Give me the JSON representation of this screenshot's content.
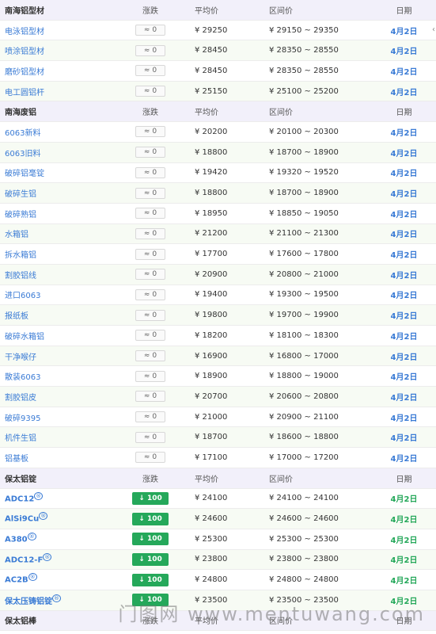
{
  "columns": {
    "change": "涨跌",
    "avg": "平均价",
    "range": "区间价",
    "date": "日期"
  },
  "sections": [
    {
      "title": "南海铝型材",
      "rows": [
        {
          "name": "电泳铝型材",
          "change": "≈ 0",
          "avg": "¥ 29250",
          "range": "¥ 29150 ~ 29350",
          "date": "4月2日"
        },
        {
          "name": "喷涂铝型材",
          "change": "≈ 0",
          "avg": "¥ 28450",
          "range": "¥ 28350 ~ 28550",
          "date": "4月2日"
        },
        {
          "name": "磨砂铝型材",
          "change": "≈ 0",
          "avg": "¥ 28450",
          "range": "¥ 28350 ~ 28550",
          "date": "4月2日"
        },
        {
          "name": "电工圆铝杆",
          "change": "≈ 0",
          "avg": "¥ 25150",
          "range": "¥ 25100 ~ 25200",
          "date": "4月2日"
        }
      ]
    },
    {
      "title": "南海废铝",
      "rows": [
        {
          "name": "6063新料",
          "change": "≈ 0",
          "avg": "¥ 20200",
          "range": "¥ 20100 ~ 20300",
          "date": "4月2日"
        },
        {
          "name": "6063旧料",
          "change": "≈ 0",
          "avg": "¥ 18800",
          "range": "¥ 18700 ~ 18900",
          "date": "4月2日"
        },
        {
          "name": "破碎铝毫锭",
          "change": "≈ 0",
          "avg": "¥ 19420",
          "range": "¥ 19320 ~ 19520",
          "date": "4月2日"
        },
        {
          "name": "破碎生铝",
          "change": "≈ 0",
          "avg": "¥ 18800",
          "range": "¥ 18700 ~ 18900",
          "date": "4月2日"
        },
        {
          "name": "破碎熟铝",
          "change": "≈ 0",
          "avg": "¥ 18950",
          "range": "¥ 18850 ~ 19050",
          "date": "4月2日"
        },
        {
          "name": "水箱铝",
          "change": "≈ 0",
          "avg": "¥ 21200",
          "range": "¥ 21100 ~ 21300",
          "date": "4月2日"
        },
        {
          "name": "拆水箱铝",
          "change": "≈ 0",
          "avg": "¥ 17700",
          "range": "¥ 17600 ~ 17800",
          "date": "4月2日"
        },
        {
          "name": "割胶铝线",
          "change": "≈ 0",
          "avg": "¥ 20900",
          "range": "¥ 20800 ~ 21000",
          "date": "4月2日"
        },
        {
          "name": "进口6063",
          "change": "≈ 0",
          "avg": "¥ 19400",
          "range": "¥ 19300 ~ 19500",
          "date": "4月2日"
        },
        {
          "name": "报纸板",
          "change": "≈ 0",
          "avg": "¥ 19800",
          "range": "¥ 19700 ~ 19900",
          "date": "4月2日"
        },
        {
          "name": "破碎水箱铝",
          "change": "≈ 0",
          "avg": "¥ 18200",
          "range": "¥ 18100 ~ 18300",
          "date": "4月2日"
        },
        {
          "name": "干净喉仔",
          "change": "≈ 0",
          "avg": "¥ 16900",
          "range": "¥ 16800 ~ 17000",
          "date": "4月2日"
        },
        {
          "name": "散装6063",
          "change": "≈ 0",
          "avg": "¥ 18900",
          "range": "¥ 18800 ~ 19000",
          "date": "4月2日"
        },
        {
          "name": "割胶铝皮",
          "change": "≈ 0",
          "avg": "¥ 20700",
          "range": "¥ 20600 ~ 20800",
          "date": "4月2日"
        },
        {
          "name": "破碎9395",
          "change": "≈ 0",
          "avg": "¥ 21000",
          "range": "¥ 20900 ~ 21100",
          "date": "4月2日"
        },
        {
          "name": "机件生铝",
          "change": "≈ 0",
          "avg": "¥ 18700",
          "range": "¥ 18600 ~ 18800",
          "date": "4月2日"
        },
        {
          "name": "铝基板",
          "change": "≈ 0",
          "avg": "¥ 17100",
          "range": "¥ 17000 ~ 17200",
          "date": "4月2日"
        }
      ]
    },
    {
      "title": "保太铝锭",
      "rows": [
        {
          "name": "ADC12",
          "reg": "®",
          "change": "↓ 100",
          "avg": "¥ 24100",
          "range": "¥ 24100 ~ 24100",
          "date": "4月2日"
        },
        {
          "name": "AlSi9Cu",
          "reg": "®",
          "change": "↓ 100",
          "avg": "¥ 24600",
          "range": "¥ 24600 ~ 24600",
          "date": "4月2日"
        },
        {
          "name": "A380",
          "reg": "®",
          "change": "↓ 100",
          "avg": "¥ 25300",
          "range": "¥ 25300 ~ 25300",
          "date": "4月2日"
        },
        {
          "name": "ADC12-F",
          "reg": "®",
          "change": "↓ 100",
          "avg": "¥ 23800",
          "range": "¥ 23800 ~ 23800",
          "date": "4月2日"
        },
        {
          "name": "AC2B",
          "reg": "®",
          "change": "↓ 100",
          "avg": "¥ 24800",
          "range": "¥ 24800 ~ 24800",
          "date": "4月2日"
        },
        {
          "name": "保太压铸铝锭",
          "reg": "®",
          "change": "↓ 100",
          "avg": "¥ 23500",
          "range": "¥ 23500 ~ 23500",
          "date": "4月2日"
        }
      ]
    },
    {
      "title": "保太铝棒",
      "rows": []
    }
  ],
  "watermark": "门图网 www.mentuwang.com",
  "colors": {
    "header_bg": "#f2f0fa",
    "alt_bg": "#f7fbf4",
    "link": "#3a7bd5",
    "down": "#25a85a"
  }
}
